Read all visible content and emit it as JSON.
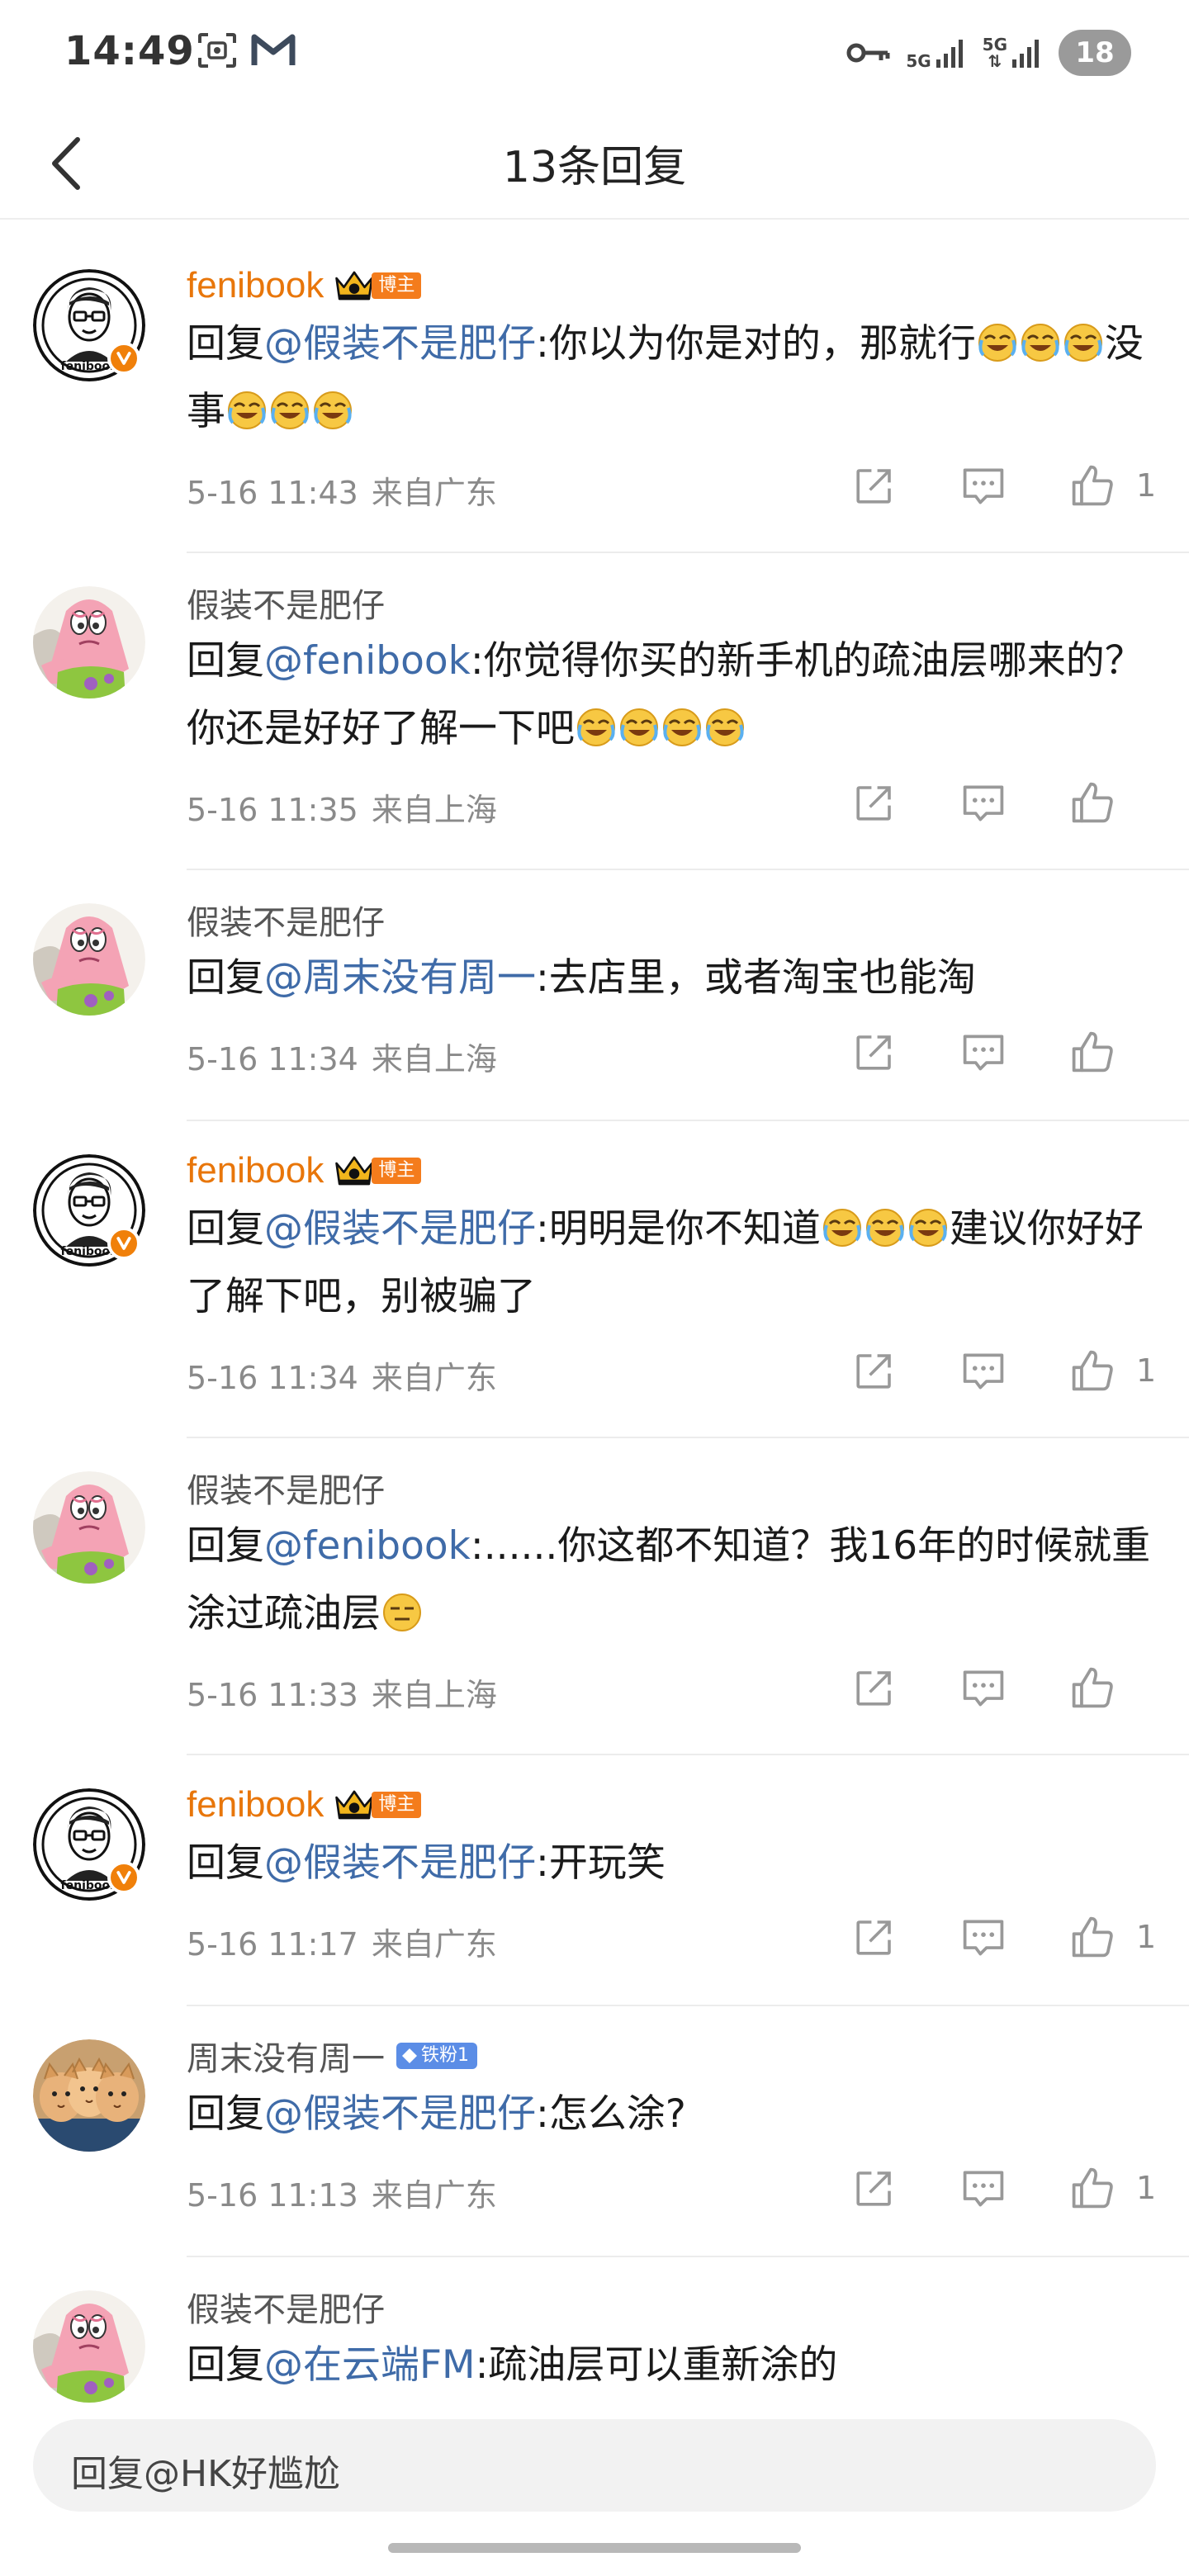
{
  "status_bar": {
    "time": "14:49",
    "net1": "5G",
    "net2": "5G",
    "battery": "18"
  },
  "nav": {
    "title": "13条回复"
  },
  "comments": [
    {
      "user": "fenibook",
      "badge": "博主",
      "reply_prefix": "回复",
      "mention": "@假装不是肥仔",
      "text_a": ":你以为你是对的，那就行",
      "text_b": "没事",
      "date": "5-16 11:43",
      "location": "来自广东",
      "likes": "1"
    },
    {
      "user": "假装不是肥仔",
      "reply_prefix": "回复",
      "mention": "@fenibook",
      "text_a": ":你觉得你买的新手机的疏油层哪来的？你还是好好了解一下吧",
      "date": "5-16 11:35",
      "location": "来自上海",
      "likes": ""
    },
    {
      "user": "假装不是肥仔",
      "reply_prefix": "回复",
      "mention": "@周末没有周一",
      "text_a": ":去店里，或者淘宝也能淘",
      "date": "5-16 11:34",
      "location": "来自上海",
      "likes": ""
    },
    {
      "user": "fenibook",
      "badge": "博主",
      "reply_prefix": "回复",
      "mention": "@假装不是肥仔",
      "text_a": ":明明是你不知道",
      "text_b": "建议你好好了解下吧，别被骗了",
      "date": "5-16 11:34",
      "location": "来自广东",
      "likes": "1"
    },
    {
      "user": "假装不是肥仔",
      "reply_prefix": "回复",
      "mention": "@fenibook",
      "text_a": ":......你这都不知道？我16年的时候就重涂过疏油层",
      "date": "5-16 11:33",
      "location": "来自上海",
      "likes": ""
    },
    {
      "user": "fenibook",
      "badge": "博主",
      "reply_prefix": "回复",
      "mention": "@假装不是肥仔",
      "text_a": ":开玩笑",
      "date": "5-16 11:17",
      "location": "来自广东",
      "likes": "1"
    },
    {
      "user": "周末没有周一",
      "fan_badge": "铁粉1",
      "reply_prefix": "回复",
      "mention": "@假装不是肥仔",
      "text_a": ":怎么涂?",
      "date": "5-16 11:13",
      "location": "来自广东",
      "likes": "1"
    },
    {
      "user": "假装不是肥仔",
      "reply_prefix": "回复",
      "mention": "@在云端FM",
      "text_a": ":疏油层可以重新涂的"
    }
  ],
  "reply_bar": {
    "placeholder": "回复@HK好尴尬"
  }
}
